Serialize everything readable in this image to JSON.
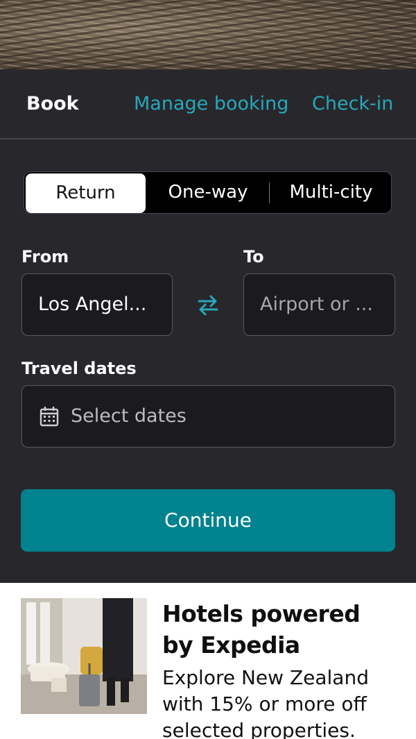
{
  "nav_tabs": {
    "book": "Book",
    "manage_booking": "Manage booking",
    "check_in": "Check-in"
  },
  "trip_type": {
    "selected": "Return",
    "options": [
      "Return",
      "One-way",
      "Multi-city"
    ]
  },
  "search_form": {
    "from_label": "From",
    "from_value": "Los Angel...",
    "to_label": "To",
    "to_placeholder": "Airport or ...",
    "dates_label": "Travel dates",
    "dates_placeholder": "Select dates",
    "continue_label": "Continue"
  },
  "icons": {
    "swap": "swap-arrows-icon",
    "calendar": "calendar-icon"
  },
  "colors": {
    "accent": "#27a8b9",
    "button": "#00828f",
    "panel": "#28272c"
  },
  "promo": {
    "title": "Hotels powered by Expedia",
    "text": "Explore New Zealand with 15% or more off selected properties."
  }
}
